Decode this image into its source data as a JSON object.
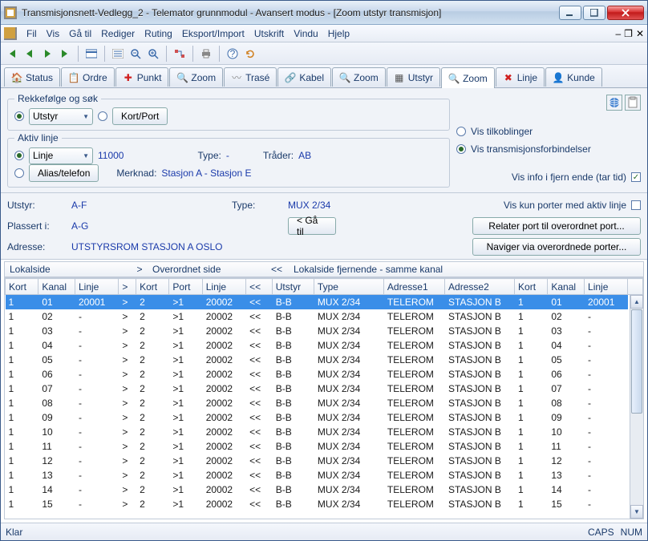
{
  "title": "Transmisjonsnett-Vedlegg_2 - Telemator grunnmodul - Avansert modus - [Zoom utstyr transmisjon]",
  "menus": [
    "Fil",
    "Vis",
    "Gå til",
    "Rediger",
    "Ruting",
    "Eksport/Import",
    "Utskrift",
    "Vindu",
    "Hjelp"
  ],
  "tabs": [
    {
      "label": "Status"
    },
    {
      "label": "Ordre"
    },
    {
      "label": "Punkt"
    },
    {
      "label": "Zoom"
    },
    {
      "label": "Trasé"
    },
    {
      "label": "Kabel"
    },
    {
      "label": "Zoom"
    },
    {
      "label": "Utstyr"
    },
    {
      "label": "Zoom",
      "active": true
    },
    {
      "label": "Linje"
    },
    {
      "label": "Kunde"
    }
  ],
  "sort": {
    "legend": "Rekkefølge og søk",
    "opt1": "Utstyr",
    "opt2": "Kort/Port"
  },
  "active": {
    "legend": "Aktiv linje",
    "linje_lbl": "Linje",
    "linje_val": "11000",
    "type_lbl": "Type:",
    "type_val": "-",
    "trader_lbl": "Tråder:",
    "trader_val": "AB",
    "alias_lbl": "Alias/telefon",
    "merknad_lbl": "Merknad:",
    "merknad_val": "Stasjon A - Stasjon E"
  },
  "vis": {
    "opt1": "Vis tilkoblinger",
    "opt2": "Vis transmisjonsforbindelser",
    "info_lbl": "Vis info i fjern ende (tar tid)"
  },
  "info": {
    "utstyr_lbl": "Utstyr:",
    "utstyr_val": "A-F",
    "type_lbl": "Type:",
    "type_val": "MUX 2/34",
    "ga_til": "< Gå til",
    "plass_lbl": "Plassert i:",
    "plass_val": "A-G",
    "adr_lbl": "Adresse:",
    "adr_val": "UTSTYRSROM STASJON A OSLO",
    "aktiv_lbl": "Vis kun porter med aktiv linje",
    "btn1": "Relater port til overordnet port...",
    "btn2": "Naviger via overordnede porter..."
  },
  "groups": {
    "g1": "Lokalside",
    "g1s": ">",
    "g2": "Overordnet side",
    "g2s": "<<",
    "g3": "Lokalside fjernende - samme kanal"
  },
  "cols": [
    "Kort",
    "Kanal",
    "Linje",
    ">",
    "Kort",
    "Port",
    "Linje",
    "<<",
    "Utstyr",
    "Type",
    "Adresse1",
    "Adresse2",
    "Kort",
    "Kanal",
    "Linje"
  ],
  "rows": [
    [
      "1",
      "01",
      "20001",
      ">",
      "2",
      ">1",
      "20002",
      "<<",
      "B-B",
      "MUX 2/34",
      "TELEROM",
      "STASJON B",
      "1",
      "01",
      "20001"
    ],
    [
      "1",
      "02",
      "-",
      ">",
      "2",
      ">1",
      "20002",
      "<<",
      "B-B",
      "MUX 2/34",
      "TELEROM",
      "STASJON B",
      "1",
      "02",
      "-"
    ],
    [
      "1",
      "03",
      "-",
      ">",
      "2",
      ">1",
      "20002",
      "<<",
      "B-B",
      "MUX 2/34",
      "TELEROM",
      "STASJON B",
      "1",
      "03",
      "-"
    ],
    [
      "1",
      "04",
      "-",
      ">",
      "2",
      ">1",
      "20002",
      "<<",
      "B-B",
      "MUX 2/34",
      "TELEROM",
      "STASJON B",
      "1",
      "04",
      "-"
    ],
    [
      "1",
      "05",
      "-",
      ">",
      "2",
      ">1",
      "20002",
      "<<",
      "B-B",
      "MUX 2/34",
      "TELEROM",
      "STASJON B",
      "1",
      "05",
      "-"
    ],
    [
      "1",
      "06",
      "-",
      ">",
      "2",
      ">1",
      "20002",
      "<<",
      "B-B",
      "MUX 2/34",
      "TELEROM",
      "STASJON B",
      "1",
      "06",
      "-"
    ],
    [
      "1",
      "07",
      "-",
      ">",
      "2",
      ">1",
      "20002",
      "<<",
      "B-B",
      "MUX 2/34",
      "TELEROM",
      "STASJON B",
      "1",
      "07",
      "-"
    ],
    [
      "1",
      "08",
      "-",
      ">",
      "2",
      ">1",
      "20002",
      "<<",
      "B-B",
      "MUX 2/34",
      "TELEROM",
      "STASJON B",
      "1",
      "08",
      "-"
    ],
    [
      "1",
      "09",
      "-",
      ">",
      "2",
      ">1",
      "20002",
      "<<",
      "B-B",
      "MUX 2/34",
      "TELEROM",
      "STASJON B",
      "1",
      "09",
      "-"
    ],
    [
      "1",
      "10",
      "-",
      ">",
      "2",
      ">1",
      "20002",
      "<<",
      "B-B",
      "MUX 2/34",
      "TELEROM",
      "STASJON B",
      "1",
      "10",
      "-"
    ],
    [
      "1",
      "11",
      "-",
      ">",
      "2",
      ">1",
      "20002",
      "<<",
      "B-B",
      "MUX 2/34",
      "TELEROM",
      "STASJON B",
      "1",
      "11",
      "-"
    ],
    [
      "1",
      "12",
      "-",
      ">",
      "2",
      ">1",
      "20002",
      "<<",
      "B-B",
      "MUX 2/34",
      "TELEROM",
      "STASJON B",
      "1",
      "12",
      "-"
    ],
    [
      "1",
      "13",
      "-",
      ">",
      "2",
      ">1",
      "20002",
      "<<",
      "B-B",
      "MUX 2/34",
      "TELEROM",
      "STASJON B",
      "1",
      "13",
      "-"
    ],
    [
      "1",
      "14",
      "-",
      ">",
      "2",
      ">1",
      "20002",
      "<<",
      "B-B",
      "MUX 2/34",
      "TELEROM",
      "STASJON B",
      "1",
      "14",
      "-"
    ],
    [
      "1",
      "15",
      "-",
      ">",
      "2",
      ">1",
      "20002",
      "<<",
      "B-B",
      "MUX 2/34",
      "TELEROM",
      "STASJON B",
      "1",
      "15",
      "-"
    ]
  ],
  "status": {
    "left": "Klar",
    "caps": "CAPS",
    "num": "NUM"
  }
}
